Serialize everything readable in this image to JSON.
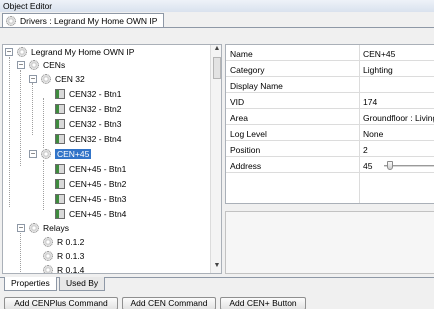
{
  "window": {
    "title": "Object Editor"
  },
  "doc_tab": {
    "label": "Drivers : Legrand My Home OWN IP"
  },
  "tree": {
    "root": "Legrand My Home OWN IP",
    "cens": "CENs",
    "cen32": "CEN 32",
    "cen32_items": [
      "CEN32 - Btn1",
      "CEN32 - Btn2",
      "CEN32 - Btn3",
      "CEN32 - Btn4"
    ],
    "cen45": "CEN+45",
    "cen45_items": [
      "CEN+45 - Btn1",
      "CEN+45 - Btn2",
      "CEN+45 - Btn3",
      "CEN+45 - Btn4"
    ],
    "relays": "Relays",
    "relay_items": [
      "R 0.1.2",
      "R 0.1.3",
      "R 0.1.4"
    ],
    "expand_symbol": "−"
  },
  "properties": {
    "rows": [
      {
        "name": "Name",
        "value": "CEN+45"
      },
      {
        "name": "Category",
        "value": "Lighting"
      },
      {
        "name": "Display Name",
        "value": ""
      },
      {
        "name": "VID",
        "value": "174"
      },
      {
        "name": "Area",
        "value": "Groundfloor : Living"
      },
      {
        "name": "Log Level",
        "value": "None"
      },
      {
        "name": "Position",
        "value": "2"
      },
      {
        "name": "Address",
        "value": "45"
      }
    ]
  },
  "bottom_tabs": {
    "properties": "Properties",
    "used_by": "Used By"
  },
  "commands": {
    "add_cenplus": "Add CENPlus Command",
    "add_cen": "Add CEN Command",
    "add_cen_button": "Add CEN+ Button"
  },
  "scroll": {
    "up": "▲",
    "down": "▼"
  }
}
